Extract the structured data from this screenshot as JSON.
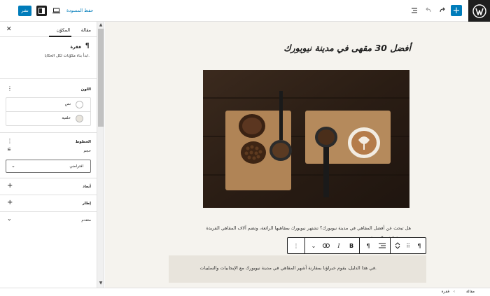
{
  "topbar": {
    "publish_label": "نشر",
    "save_draft_label": "حفظ المسودة"
  },
  "sidebar": {
    "tabs": [
      {
        "label": "مقالة",
        "active": false
      },
      {
        "label": "المكوّن",
        "active": true
      }
    ],
    "block": {
      "title": "فقرة",
      "description": "ابدأ بناء مكوّنات لكل الحكايا."
    },
    "color_panel": {
      "title": "اللون",
      "items": [
        "نص",
        "خلفية"
      ]
    },
    "typography_panel": {
      "title": "الخطوط",
      "size_label": "حجم",
      "size_value": "افتراضي"
    },
    "dimensions_title": "أبعاد",
    "border_title": "إطار",
    "advanced_title": "متقدم"
  },
  "canvas": {
    "title": "أفضل 30 مقهى في مدينة نيويورك",
    "paragraph1": "هل تبحث عن أفضل المقاهي في مدينة نيويورك؟ تشتهر نيويورك بمقاهيها الرائعة، وتضم آلاف المقاهي الفريدة من نوعها في المدينة.",
    "paragraph2": "في هذا الدليل، يقوم خبراؤنا بمقارنة أشهر المقاهي في مدينة نيويورك مع الإيجابيات والسلبيات."
  },
  "footer": {
    "breadcrumbs": [
      "مقالة",
      "فقرة"
    ]
  },
  "colors": {
    "accent": "#007cba",
    "dark": "#1e1e1e",
    "canvas_bg": "#f5f3ee",
    "highlight_bg": "#e8e4dc"
  }
}
